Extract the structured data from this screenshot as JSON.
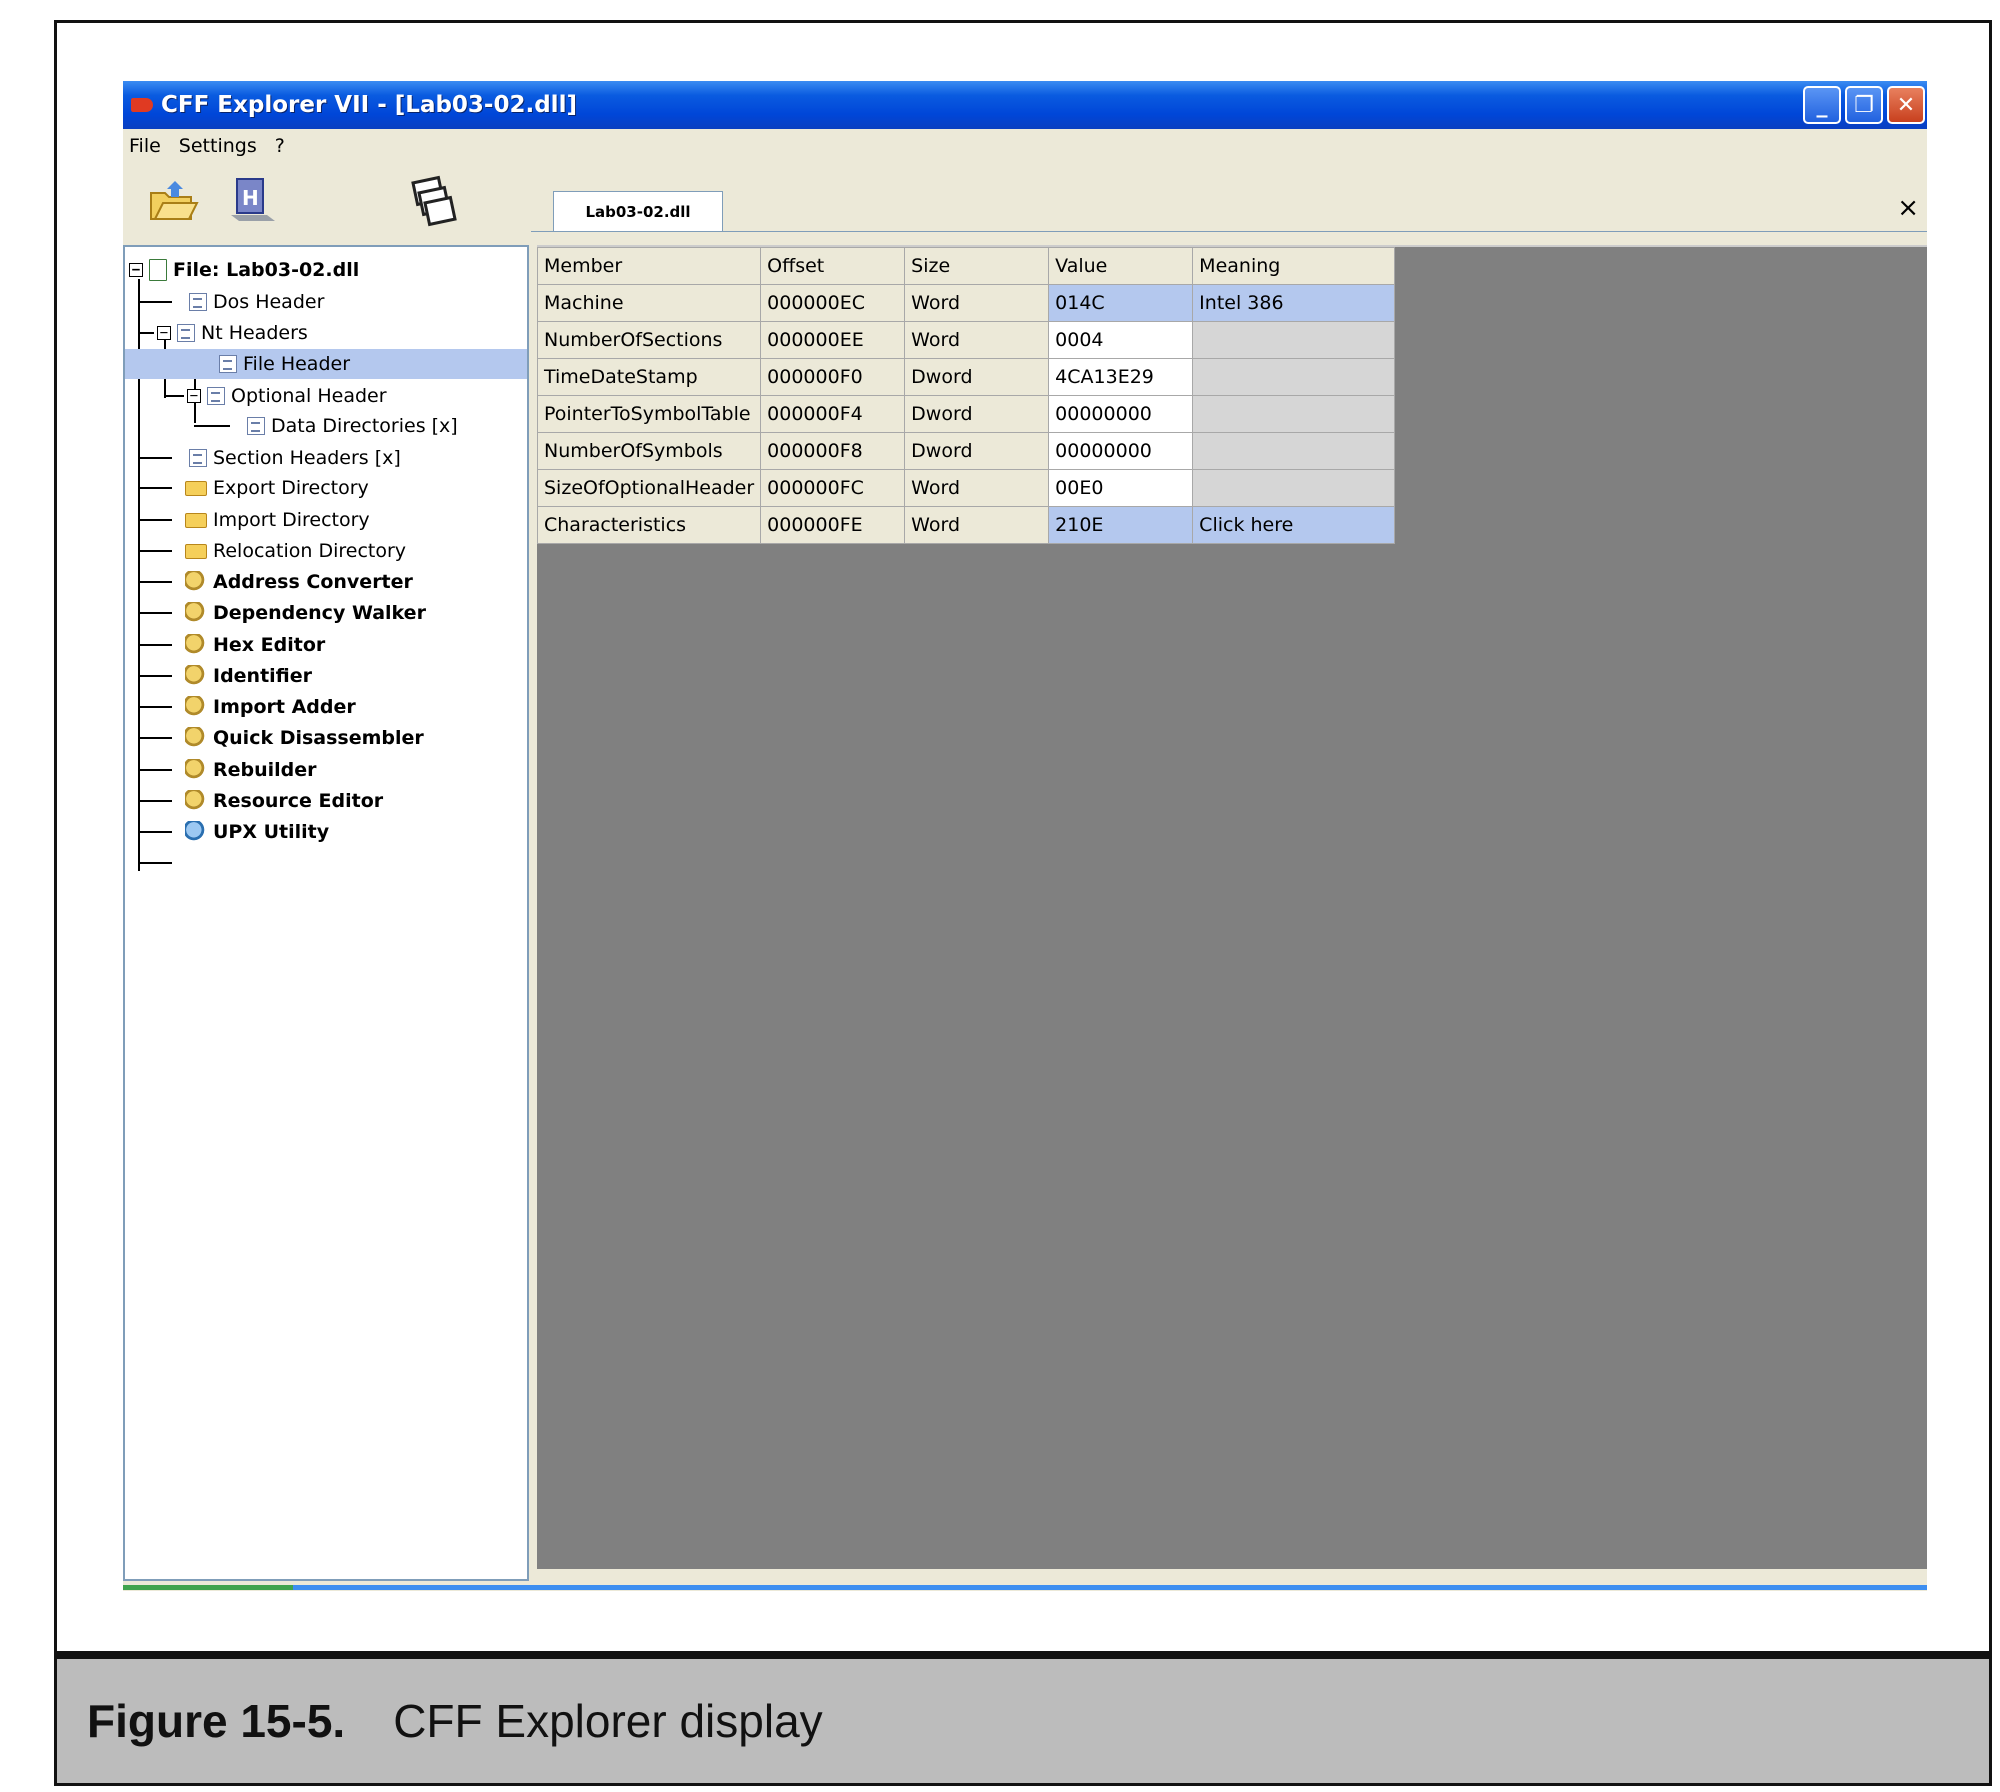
{
  "window": {
    "title": "CFF Explorer VII - [Lab03-02.dll]",
    "buttons": {
      "minimize": "_",
      "restore": "❐",
      "close": "✕"
    }
  },
  "menu": [
    "File",
    "Settings",
    "?"
  ],
  "toolbar": {
    "icons": [
      "open-folder-icon",
      "save-disk-icon",
      "windows-cascade-icon"
    ]
  },
  "tree": {
    "root": "File: Lab03-02.dll",
    "items": [
      {
        "label": "Dos Header",
        "icon": "doc-icon"
      },
      {
        "label": "Nt Headers",
        "icon": "doc-icon"
      },
      {
        "label": "File Header",
        "icon": "doc-icon"
      },
      {
        "label": "Optional Header",
        "icon": "doc-icon"
      },
      {
        "label": "Data Directories [x]",
        "icon": "doc-icon"
      },
      {
        "label": "Section Headers [x]",
        "icon": "doc-icon"
      },
      {
        "label": "Export Directory",
        "icon": "folder-icon"
      },
      {
        "label": "Import Directory",
        "icon": "folder-icon"
      },
      {
        "label": "Relocation Directory",
        "icon": "folder-icon"
      },
      {
        "label": "Address Converter",
        "icon": "tool-icon"
      },
      {
        "label": "Dependency Walker",
        "icon": "tool-icon"
      },
      {
        "label": "Hex Editor",
        "icon": "tool-icon"
      },
      {
        "label": "Identifier",
        "icon": "tool-icon"
      },
      {
        "label": "Import Adder",
        "icon": "tool-icon"
      },
      {
        "label": "Quick Disassembler",
        "icon": "tool-icon"
      },
      {
        "label": "Rebuilder",
        "icon": "tool-icon"
      },
      {
        "label": "Resource Editor",
        "icon": "tool-icon"
      },
      {
        "label": "UPX Utility",
        "icon": "tool-icon"
      }
    ],
    "selected": "File Header"
  },
  "tab": {
    "label": "Lab03-02.dll",
    "close": "×"
  },
  "table": {
    "headers": [
      "Member",
      "Offset",
      "Size",
      "Value",
      "Meaning"
    ],
    "rows": [
      [
        "Machine",
        "000000EC",
        "Word",
        "014C",
        "Intel 386"
      ],
      [
        "NumberOfSections",
        "000000EE",
        "Word",
        "0004",
        ""
      ],
      [
        "TimeDateStamp",
        "000000F0",
        "Dword",
        "4CA13E29",
        ""
      ],
      [
        "PointerToSymbolTable",
        "000000F4",
        "Dword",
        "00000000",
        ""
      ],
      [
        "NumberOfSymbols",
        "000000F8",
        "Dword",
        "00000000",
        ""
      ],
      [
        "SizeOfOptionalHeader",
        "000000FC",
        "Word",
        "00E0",
        ""
      ],
      [
        "Characteristics",
        "000000FE",
        "Word",
        "210E",
        "Click here"
      ]
    ],
    "highlighted_rows": [
      0,
      6
    ]
  },
  "caption": {
    "number": "Figure 15-5.",
    "text": "CFF Explorer display"
  },
  "colors": {
    "selection": "#b4c8ee",
    "titlebar": "#0046d8",
    "content_bg": "#808080"
  }
}
